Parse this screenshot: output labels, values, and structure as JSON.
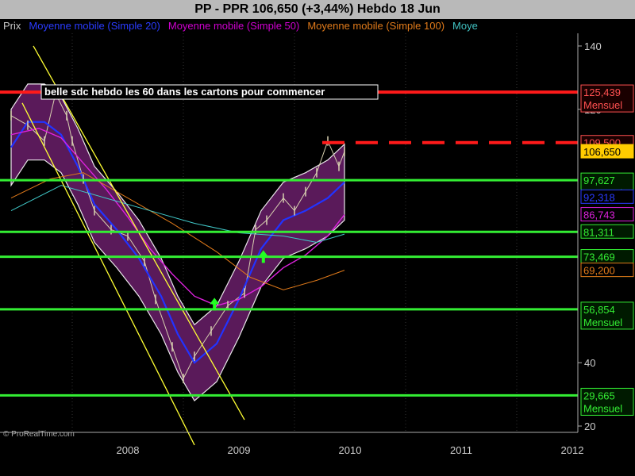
{
  "header": {
    "title": "PP - PPR      106,650 (+3,44%)     Hebdo  18 Jun"
  },
  "legend": {
    "items": [
      {
        "label": "Prix",
        "color": "#c8c8c8"
      },
      {
        "label": "Moyenne mobile (Simple 20)",
        "color": "#2a3bff"
      },
      {
        "label": "Moyenne mobile (Simple 50)",
        "color": "#d000d0"
      },
      {
        "label": "Moyenne mobile (Simple 100)",
        "color": "#e07a1a"
      },
      {
        "label": "Moye",
        "color": "#40c0c0"
      }
    ]
  },
  "annotation": "belle sdc hebdo les 60 dans les cartons pour commencer",
  "watermark": "© ProRealTime.com",
  "colors": {
    "background": "#000000",
    "band_fill": "#5a1a5a",
    "price": "#d8d0b0",
    "ma20": "#2233ff",
    "ma50": "#dd22dd",
    "ma100": "#e07a1a",
    "ma200": "#40c8c8",
    "resistance": "#ff1a1a",
    "support": "#33ee33",
    "trend": "#ffff33",
    "axis_bg": "#000000"
  },
  "chart_data": {
    "type": "line",
    "title": "PP - PPR      106,650 (+3,44%)     Hebdo  18 Jun",
    "x_labels": [
      "2008",
      "2009",
      "2010",
      "2011",
      "2012"
    ],
    "x_range": [
      2007.35,
      2012.55
    ],
    "ylim": [
      18,
      144
    ],
    "y_ticks": [
      140,
      120,
      40,
      20
    ],
    "series": [
      {
        "name": "Prix",
        "x": [
          2007.45,
          2007.6,
          2007.75,
          2007.85,
          2007.95,
          2008.0,
          2008.1,
          2008.2,
          2008.35,
          2008.5,
          2008.65,
          2008.75,
          2008.9,
          2009.0,
          2009.1,
          2009.25,
          2009.4,
          2009.55,
          2009.65,
          2009.75,
          2009.9,
          2010.0,
          2010.1,
          2010.2,
          2010.3,
          2010.4,
          2010.45
        ],
        "y": [
          118,
          115,
          110,
          125,
          118,
          110,
          98,
          88,
          82,
          80,
          72,
          60,
          45,
          35,
          42,
          50,
          58,
          62,
          82,
          85,
          92,
          88,
          94,
          100,
          110,
          102,
          106.65
        ]
      },
      {
        "name": "Moyenne mobile (Simple 20)",
        "x": [
          2007.45,
          2007.6,
          2007.75,
          2007.9,
          2008.05,
          2008.2,
          2008.4,
          2008.6,
          2008.8,
          2008.95,
          2009.1,
          2009.3,
          2009.5,
          2009.7,
          2009.9,
          2010.1,
          2010.3,
          2010.45
        ],
        "y": [
          108,
          116,
          116,
          112,
          102,
          90,
          82,
          73,
          61,
          49,
          40,
          46,
          60,
          76,
          85,
          88,
          92,
          97
        ]
      },
      {
        "name": "Moyenne mobile (Simple 50)",
        "x": [
          2007.45,
          2007.7,
          2007.9,
          2008.1,
          2008.3,
          2008.5,
          2008.7,
          2008.9,
          2009.1,
          2009.3,
          2009.5,
          2009.7,
          2009.9,
          2010.1,
          2010.3,
          2010.45
        ],
        "y": [
          112,
          114,
          111,
          103,
          95,
          86,
          76,
          68,
          61,
          58,
          60,
          64,
          70,
          74,
          80,
          86.743
        ]
      },
      {
        "name": "Moyenne mobile (Simple 100)",
        "x": [
          2007.45,
          2007.8,
          2008.1,
          2008.5,
          2008.9,
          2009.3,
          2009.6,
          2009.9,
          2010.2,
          2010.45
        ],
        "y": [
          92,
          98,
          100,
          92,
          84,
          75,
          67,
          63,
          66,
          69.2
        ]
      },
      {
        "name": "Moye",
        "x": [
          2007.45,
          2007.9,
          2008.3,
          2008.7,
          2009.1,
          2009.5,
          2009.9,
          2010.2,
          2010.45
        ],
        "y": [
          88,
          96,
          92,
          88,
          84,
          81,
          80,
          78,
          80.6
        ]
      }
    ],
    "horizontal_levels": [
      {
        "value": 125.439,
        "kind": "resistance",
        "label": "125,439",
        "sublabel": "Mensuel"
      },
      {
        "value": 109.5,
        "kind": "resistance-dashed",
        "label": "109,500",
        "sublabel": ""
      },
      {
        "value": 97.627,
        "kind": "support",
        "label": "97,627",
        "sublabel": "Mensuel"
      },
      {
        "value": 81.311,
        "kind": "support",
        "label": "81,311",
        "sublabel": ""
      },
      {
        "value": 73.469,
        "kind": "support",
        "label": "73,469",
        "sublabel": "Mensuel"
      },
      {
        "value": 56.854,
        "kind": "support",
        "label": "56,854",
        "sublabel": "Mensuel"
      },
      {
        "value": 29.665,
        "kind": "support",
        "label": "29,665",
        "sublabel": "Mensuel"
      }
    ],
    "price_tags": [
      {
        "value": 106.65,
        "label": "106,650",
        "bg": "#ffcc00",
        "fg": "#000000"
      },
      {
        "value": 92.318,
        "label": "92,318",
        "bg": "#000000",
        "fg": "#2a3bff"
      },
      {
        "value": 86.743,
        "label": "86,743",
        "bg": "#000000",
        "fg": "#dd22dd"
      },
      {
        "value": 69.2,
        "label": "69,200",
        "bg": "#000000",
        "fg": "#e07a1a"
      }
    ],
    "trendlines": [
      {
        "x1": 2007.65,
        "y1": 140,
        "x2": 2009.55,
        "y2": 22
      },
      {
        "x1": 2007.55,
        "y1": 122,
        "x2": 2009.1,
        "y2": 14
      }
    ],
    "arrows": [
      {
        "x": 2009.28,
        "y": 58
      },
      {
        "x": 2009.72,
        "y": 73
      }
    ]
  }
}
